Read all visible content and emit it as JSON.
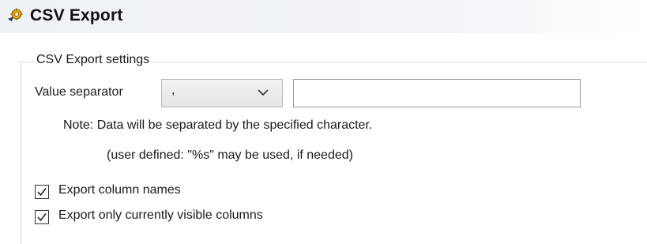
{
  "header": {
    "icon": "csv-export-gear-icon",
    "title": "CSV Export"
  },
  "settings": {
    "group_title": "CSV Export settings",
    "value_separator_label": "Value separator",
    "separator_select_value": ",",
    "separator_custom_value": "",
    "note_line1": "Note: Data will be separated by the specified character.",
    "note_line2": "(user defined: \"%s\" may be used, if needed)",
    "checkboxes": [
      {
        "label": "Export column names",
        "checked": true
      },
      {
        "label": "Export only currently visible columns",
        "checked": true
      }
    ]
  },
  "colors": {
    "accent_icon": "#d4a017",
    "checkmark": "#222222"
  }
}
